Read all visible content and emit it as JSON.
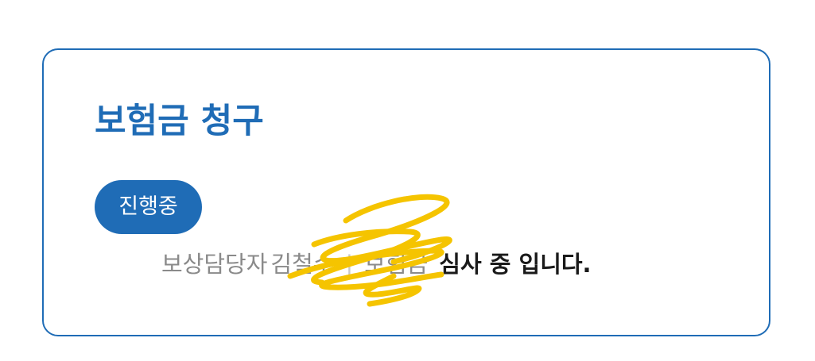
{
  "card": {
    "title": "보험금 청구",
    "badge": "진행중",
    "status": {
      "manager_label": "보상담당자",
      "manager_name": "김철수",
      "divider": "|",
      "claim_label": "보험금",
      "status_text": "심사 중 입니다."
    }
  },
  "colors": {
    "accent": "#1f6cb6",
    "border": "#1f6cb6",
    "muted_text": "#8a8a8a",
    "strong_text": "#1a1a1a",
    "redaction_scribble": "#f5c400"
  }
}
